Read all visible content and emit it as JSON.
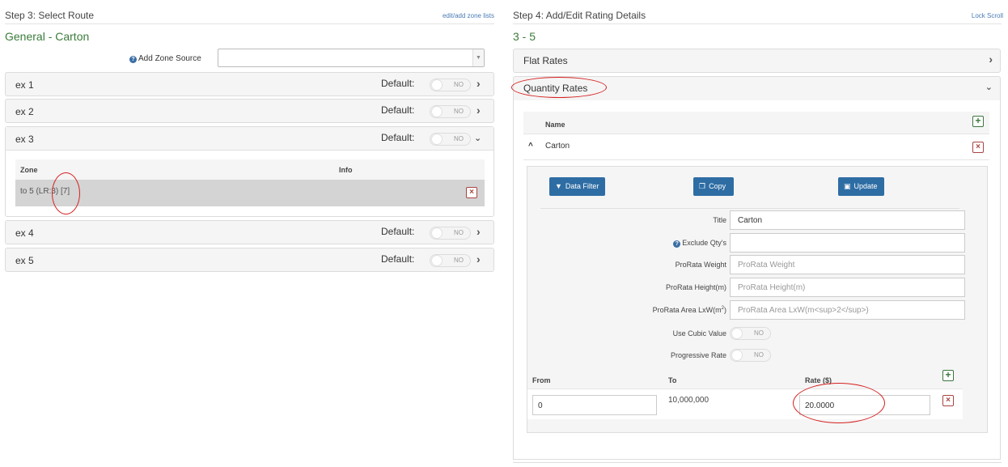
{
  "left": {
    "step_title": "Step 3: Select Route",
    "edit_link": "edit/add zone lists",
    "route_name": "General - Carton",
    "add_zone_source_label": "Add Zone Source",
    "add_zone_source_value": "",
    "default_label": "Default:",
    "toggle_off_text": "NO",
    "routes": [
      {
        "name": "ex 1",
        "default": "NO"
      },
      {
        "name": "ex 2",
        "default": "NO"
      },
      {
        "name": "ex 3",
        "default": "NO",
        "expanded": true
      },
      {
        "name": "ex 4",
        "default": "NO"
      },
      {
        "name": "ex 5",
        "default": "NO"
      }
    ],
    "zone_table": {
      "headers": [
        "Zone",
        "Info"
      ],
      "rows": [
        {
          "zone": "to 5 (LR:3) [7]",
          "info": ""
        }
      ]
    }
  },
  "right": {
    "step_title": "Step 4: Add/Edit Rating Details",
    "lock_link": "Lock Scroll",
    "zone_range": "3 - 5",
    "flat_rates_label": "Flat Rates",
    "quantity_rates_label": "Quantity Rates",
    "name_header": "Name",
    "rate_name": "Carton",
    "buttons": {
      "data_filter": "Data Filter",
      "copy": "Copy",
      "update": "Update"
    },
    "fields": {
      "title_label": "Title",
      "title_value": "Carton",
      "exclude_label": "Exclude Qty's",
      "exclude_value": "",
      "prorata_weight_label": "ProRata Weight",
      "prorata_weight_placeholder": "ProRata Weight",
      "prorata_height_label": "ProRata Height(m)",
      "prorata_height_placeholder": "ProRata Height(m)",
      "prorata_area_label_main": "ProRata Area LxW(m",
      "prorata_area_label_sup": "2",
      "prorata_area_label_end": ")",
      "prorata_area_placeholder": "ProRata Area LxW(m<sup>2</sup>)",
      "use_cubic_label": "Use Cubic Value",
      "use_cubic_value": "NO",
      "progressive_label": "Progressive Rate",
      "progressive_value": "NO"
    },
    "range_table": {
      "headers": {
        "from": "From",
        "to": "To",
        "rate": "Rate ($)"
      },
      "rows": [
        {
          "from": "0",
          "to": "10,000,000",
          "rate": "20.0000"
        }
      ]
    }
  },
  "colors": {
    "accent_green": "#3a7c3a",
    "button_blue": "#2e6da4",
    "delete_red": "#a94442",
    "annotation_red": "#d62020"
  }
}
